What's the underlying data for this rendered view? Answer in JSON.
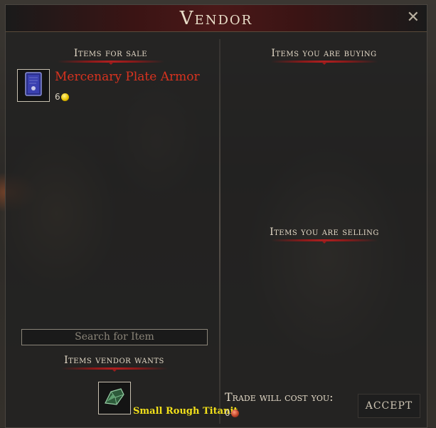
{
  "window": {
    "title": "Vendor",
    "close_glyph": "✕"
  },
  "sections": {
    "for_sale": "Items for sale",
    "buying": "Items you are buying",
    "selling": "Items you are selling",
    "vendor_wants": "Items vendor wants"
  },
  "for_sale_items": [
    {
      "name": "Mercenary Plate Armor",
      "price": "6",
      "icon": "armor-book-icon",
      "currency": "gold-coin-icon"
    }
  ],
  "search": {
    "placeholder": "Search for Item"
  },
  "wanted_items": [
    {
      "name": "Small Rough Titanit",
      "icon": "rough-gem-icon"
    }
  ],
  "trade": {
    "label": "Trade will cost you:",
    "cost": "0",
    "currency": "copper-coin-icon"
  },
  "accept_label": "ACCEPT",
  "colors": {
    "item_name": "#d8331f",
    "wanted_name": "#f2e01a",
    "title_bar": "#4a1818"
  }
}
